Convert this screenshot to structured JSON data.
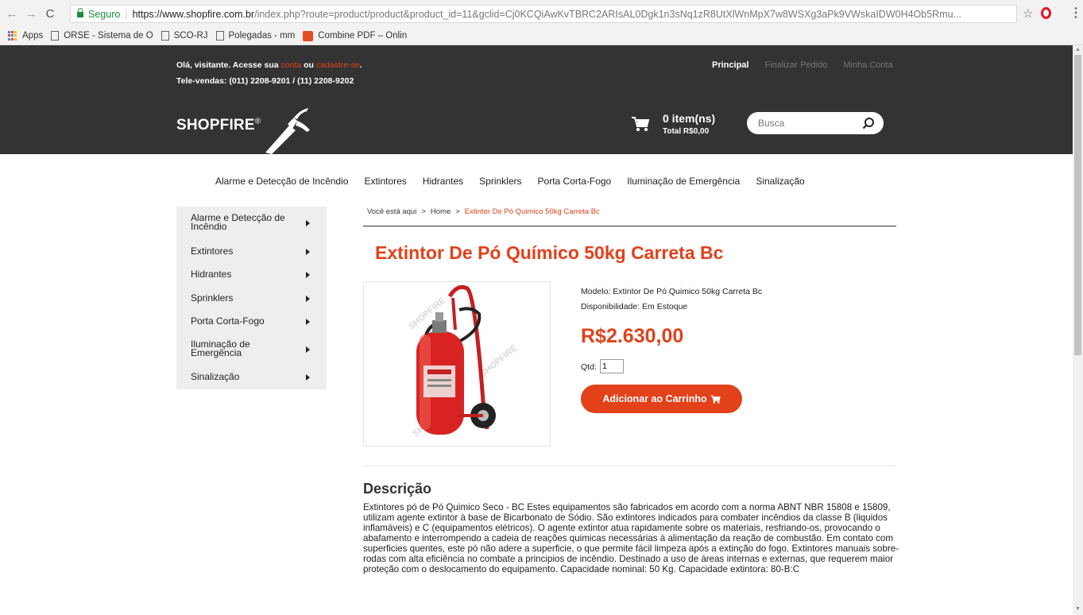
{
  "browser": {
    "secure_label": "Seguro",
    "url_main": "https://www.shopfire.com.br",
    "url_rest": "/index.php?route=product/product&product_id=11&gclid=Cj0KCQiAwKvTBRC2ARIsAL0Dgk1n3sNq1zR8UtXlWnMpX7w8WSXg3aPk9VWskaIDW0H4Ob5Rmu...",
    "bookmarks": [
      "Apps",
      "ORSE - Sistema de O",
      "SCO-RJ",
      "Polegadas - mm",
      "Combine PDF – Onlin"
    ]
  },
  "header": {
    "greeting_prefix": "Olá, visitante. Acesse sua ",
    "conta_link": "conta",
    "ou": " ou ",
    "cadastre_link": "cadastre-se",
    "greeting_suffix": ".",
    "phone": "Tele-vendas: (011) 2208-9201 / (11) 2208-9202",
    "links": {
      "principal": "Principal",
      "finalizar": "Finalizar Pedido",
      "minha_conta": "Minha Conta"
    },
    "logo_text": "SHOPFIRE",
    "logo_mark": "®",
    "cart_count": "0 item(ns)",
    "cart_total": "Total R$0,00",
    "search_placeholder": "Busca"
  },
  "category_nav": [
    "Alarme e Detecção de Incêndio",
    "Extintores",
    "Hidrantes",
    "Sprinklers",
    "Porta Corta-Fogo",
    "Iluminação de Emergência",
    "Sinalização"
  ],
  "sidebar": {
    "items": [
      "Alarme e Detecção de Incêndio",
      "Extintores",
      "Hidrantes",
      "Sprinklers",
      "Porta Corta-Fogo",
      "Iluminação de Emergência",
      "Sinalização"
    ]
  },
  "breadcrumb": {
    "you_are_here": "Você está aqui",
    "home": "Home",
    "current": "Extintor De Pó Quimico 50kg Carreta Bc",
    "separator": ">"
  },
  "product": {
    "title": "Extintor De Pó Químico 50kg Carreta Bc",
    "model": "Modelo: Extintor De Pó Quimico 50kg Carreta Bc",
    "availability": "Disponibilidade: Em Estoque",
    "price": "R$2.630,00",
    "qty_label": "Qtd:",
    "qty_value": "1",
    "add_button": "Adicionar ao Carrinho",
    "image_watermark": "SHOPFIRE"
  },
  "description": {
    "title": "Descrição",
    "text": "Extintores pó de Pó Quimico Seco - BC Estes equipamentos são fabricados em acordo com a norma ABNT NBR 15808 e 15809, utilizam agente extintor à base de Bicarbonato de Sódio. São extintores indicados para combater incêndios da classe B (liquidos inflamáveis) e C (equipamentos elétricos). O agente extintor atua rapidamente sobre os materiais, resfriando-os, provocando o abafamento e interrompendo a cadeia de reações quimicas necessárias à alimentação da reação de combustão. Em contato com superficies quentes, este pó não adere a superficie, o que permite fácil limpeza após a extinção do fogo. Extintores manuais sobre-rodas com alta eficiência no combate a principios de incêndio. Destinado a uso de áreas internas e externas, que requerem maior proteção com o deslocamento do equipamento. Capacidade nominal: 50 Kg. Capacidade extintora: 80-B:C"
  },
  "colors": {
    "accent": "#e2411a",
    "header_bg": "#333333",
    "sidebar_bg": "#eeeeee"
  }
}
